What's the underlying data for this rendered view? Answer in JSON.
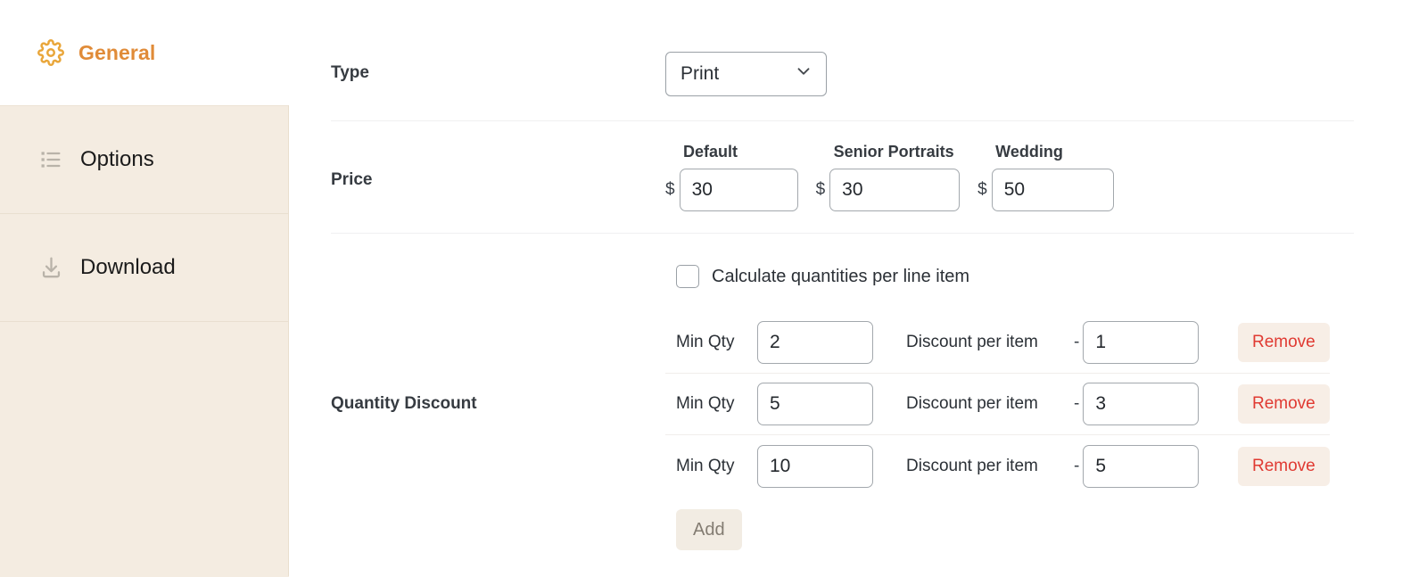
{
  "sidebar": {
    "header": {
      "label": "General",
      "icon": "gear-icon",
      "accent": "#e08b38"
    },
    "items": [
      {
        "label": "Options",
        "icon": "list-icon"
      },
      {
        "label": "Download",
        "icon": "download-icon"
      }
    ],
    "background": "#f4ece1"
  },
  "form": {
    "type": {
      "label": "Type",
      "select_value": "Print",
      "chevron": "chevron-down-icon"
    },
    "price": {
      "label": "Price",
      "currency_symbol": "$",
      "columns": [
        {
          "header": "Default",
          "value": "30"
        },
        {
          "header": "Senior Portraits",
          "value": "30"
        },
        {
          "header": "Wedding",
          "value": "50"
        }
      ]
    },
    "quantity_discount": {
      "label": "Quantity Discount",
      "checkbox": {
        "label": "Calculate quantities per line item",
        "checked": false
      },
      "min_qty_label": "Min Qty",
      "discount_label": "Discount per item",
      "minus_sign": "-",
      "remove_label": "Remove",
      "add_label": "Add",
      "rows": [
        {
          "min_qty": "2",
          "discount": "1"
        },
        {
          "min_qty": "5",
          "discount": "3"
        },
        {
          "min_qty": "10",
          "discount": "5"
        }
      ]
    }
  },
  "colors": {
    "accent_orange": "#e08b38",
    "remove_red": "#e03a32",
    "remove_bg": "#f7eee6",
    "add_bg": "#f2ece3",
    "sidebar_bg": "#f4ece1"
  }
}
